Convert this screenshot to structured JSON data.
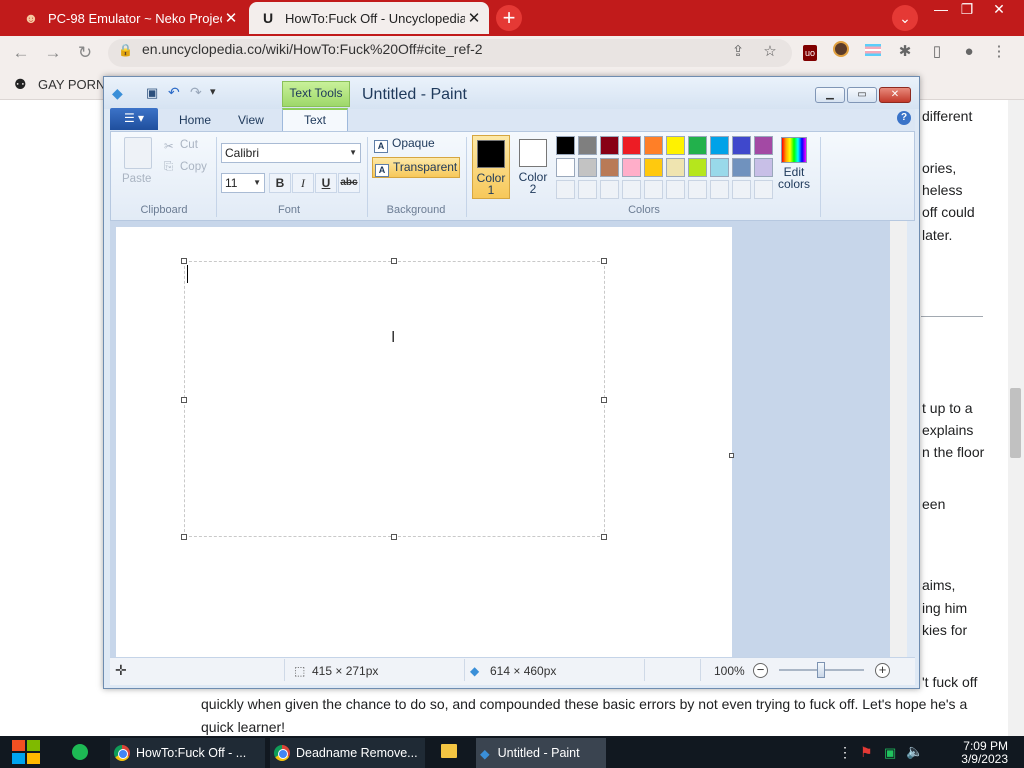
{
  "browser": {
    "tabs": [
      {
        "title": "PC-98 Emulator ~ Neko Project",
        "favicon": "cat-icon",
        "active": false
      },
      {
        "title": "HowTo:Fuck Off - Uncyclopedia",
        "favicon": "uncyclopedia-icon",
        "active": true
      }
    ],
    "new_tab": "+",
    "url_host": "en.uncyclopedia.co",
    "url_path": "/wiki/HowTo:Fuck%20Off#cite_ref-2",
    "bookmark_label": "GAY PORN",
    "accent": "#c11b1b"
  },
  "page": {
    "fragments": [
      "different",
      "ories,",
      "heless",
      "off could",
      "later.",
      "t up to a",
      "explains",
      "n the floor",
      "een",
      "aims,",
      "ing him",
      "kies for",
      "'t fuck off",
      "quickly when given the chance to do so, and compounded these basic errors by not even trying to fuck off. Let's hope he's a",
      "quick learner!"
    ]
  },
  "paint": {
    "title": "Untitled - Paint",
    "context_tab": "Text Tools",
    "tabs": {
      "home": "Home",
      "view": "View",
      "text": "Text"
    },
    "clipboard": {
      "paste": "Paste",
      "cut": "Cut",
      "copy": "Copy",
      "group": "Clipboard"
    },
    "font": {
      "family": "Calibri",
      "size": "11",
      "bold": "B",
      "italic": "I",
      "underline": "U",
      "strike": "abc",
      "group": "Font"
    },
    "background": {
      "opaque": "Opaque",
      "transparent": "Transparent",
      "group": "Background"
    },
    "colors": {
      "color1_label": "Color 1",
      "color2_label": "Color 2",
      "color1": "#000000",
      "color2": "#ffffff",
      "group": "Colors",
      "edit_label": "Edit colors",
      "palette_row1": [
        "#000000",
        "#7f7f7f",
        "#880015",
        "#ed1c24",
        "#ff7f27",
        "#fff200",
        "#22b14c",
        "#00a2e8",
        "#3f48cc",
        "#a349a4"
      ],
      "palette_row2": [
        "#ffffff",
        "#c3c3c3",
        "#b97a57",
        "#ffaec9",
        "#ffc90e",
        "#efe4b0",
        "#b5e61d",
        "#99d9ea",
        "#7092be",
        "#c8bfe7"
      ]
    },
    "status": {
      "selection_size": "415 × 271px",
      "canvas_size": "614 × 460px",
      "zoom": "100%"
    }
  },
  "taskbar": {
    "items": [
      "HowTo:Fuck Off - ...",
      "Deadname Remove...",
      "Untitled - Paint"
    ],
    "time": "7:09 PM",
    "date": "3/9/2023"
  }
}
